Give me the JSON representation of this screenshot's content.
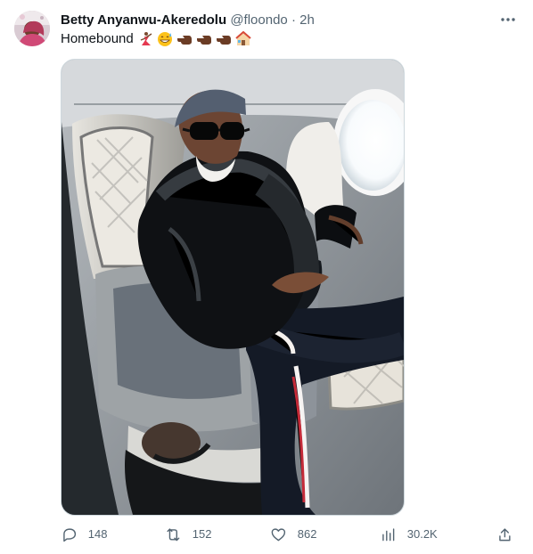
{
  "tweet": {
    "author_name": "Betty Anyanwu-Akeredolu",
    "handle": "@floondo",
    "separator": "·",
    "time": "2h",
    "text": "Homebound",
    "emojis": [
      "dancer",
      "grinning-sweat-face",
      "pointing-left-dark",
      "pointing-left-dark",
      "pointing-left-dark",
      "house"
    ],
    "image_description_icon": "photo"
  },
  "actions": {
    "replies": "148",
    "reposts": "152",
    "likes": "862",
    "views": "30.2K"
  },
  "colors": {
    "text": "#0f1419",
    "secondary": "#536471",
    "border": "#cfd9de"
  }
}
